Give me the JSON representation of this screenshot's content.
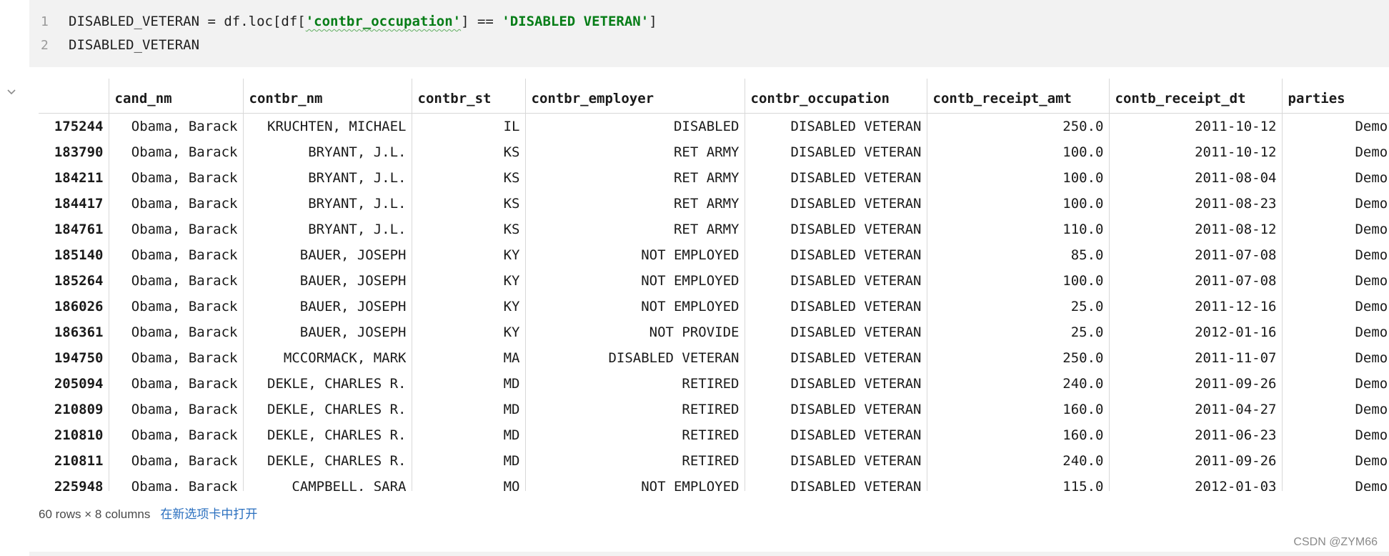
{
  "editor": {
    "line_numbers": [
      "1",
      "2"
    ],
    "line1": {
      "prefix": "DISABLED_VETERAN = df.loc[df[",
      "str1": "'contbr_occupation'",
      "mid": "] == ",
      "str2": "'DISABLED VETERAN'",
      "suffix": "]"
    },
    "line2": "DISABLED_VETERAN"
  },
  "table": {
    "columns": [
      "",
      "cand_nm",
      "contbr_nm",
      "contbr_st",
      "contbr_employer",
      "contbr_occupation",
      "contb_receipt_amt",
      "contb_receipt_dt",
      "parties"
    ],
    "rows": [
      [
        "175244",
        "Obama, Barack",
        "KRUCHTEN, MICHAEL",
        "IL",
        "DISABLED",
        "DISABLED VETERAN",
        "250.0",
        "2011-10-12",
        "Democrat"
      ],
      [
        "183790",
        "Obama, Barack",
        "BRYANT, J.L.",
        "KS",
        "RET ARMY",
        "DISABLED VETERAN",
        "100.0",
        "2011-10-12",
        "Democrat"
      ],
      [
        "184211",
        "Obama, Barack",
        "BRYANT, J.L.",
        "KS",
        "RET ARMY",
        "DISABLED VETERAN",
        "100.0",
        "2011-08-04",
        "Democrat"
      ],
      [
        "184417",
        "Obama, Barack",
        "BRYANT, J.L.",
        "KS",
        "RET ARMY",
        "DISABLED VETERAN",
        "100.0",
        "2011-08-23",
        "Democrat"
      ],
      [
        "184761",
        "Obama, Barack",
        "BRYANT, J.L.",
        "KS",
        "RET ARMY",
        "DISABLED VETERAN",
        "110.0",
        "2011-08-12",
        "Democrat"
      ],
      [
        "185140",
        "Obama, Barack",
        "BAUER, JOSEPH",
        "KY",
        "NOT EMPLOYED",
        "DISABLED VETERAN",
        "85.0",
        "2011-07-08",
        "Democrat"
      ],
      [
        "185264",
        "Obama, Barack",
        "BAUER, JOSEPH",
        "KY",
        "NOT EMPLOYED",
        "DISABLED VETERAN",
        "100.0",
        "2011-07-08",
        "Democrat"
      ],
      [
        "186026",
        "Obama, Barack",
        "BAUER, JOSEPH",
        "KY",
        "NOT EMPLOYED",
        "DISABLED VETERAN",
        "25.0",
        "2011-12-16",
        "Democrat"
      ],
      [
        "186361",
        "Obama, Barack",
        "BAUER, JOSEPH",
        "KY",
        "NOT PROVIDE",
        "DISABLED VETERAN",
        "25.0",
        "2012-01-16",
        "Democrat"
      ],
      [
        "194750",
        "Obama, Barack",
        "MCCORMACK, MARK",
        "MA",
        "DISABLED VETERAN",
        "DISABLED VETERAN",
        "250.0",
        "2011-11-07",
        "Democrat"
      ],
      [
        "205094",
        "Obama, Barack",
        "DEKLE, CHARLES R.",
        "MD",
        "RETIRED",
        "DISABLED VETERAN",
        "240.0",
        "2011-09-26",
        "Democrat"
      ],
      [
        "210809",
        "Obama, Barack",
        "DEKLE, CHARLES R.",
        "MD",
        "RETIRED",
        "DISABLED VETERAN",
        "160.0",
        "2011-04-27",
        "Democrat"
      ],
      [
        "210810",
        "Obama, Barack",
        "DEKLE, CHARLES R.",
        "MD",
        "RETIRED",
        "DISABLED VETERAN",
        "160.0",
        "2011-06-23",
        "Democrat"
      ],
      [
        "210811",
        "Obama, Barack",
        "DEKLE, CHARLES R.",
        "MD",
        "RETIRED",
        "DISABLED VETERAN",
        "240.0",
        "2011-09-26",
        "Democrat"
      ],
      [
        "225948",
        "Obama, Barack",
        "CAMPBELL, SARA",
        "MO",
        "NOT EMPLOYED",
        "DISABLED VETERAN",
        "115.0",
        "2012-01-03",
        "Democrat"
      ]
    ]
  },
  "footer": {
    "summary": "60 rows × 8 columns",
    "open_link": "在新选项卡中打开"
  },
  "watermark": "CSDN @ZYM66"
}
